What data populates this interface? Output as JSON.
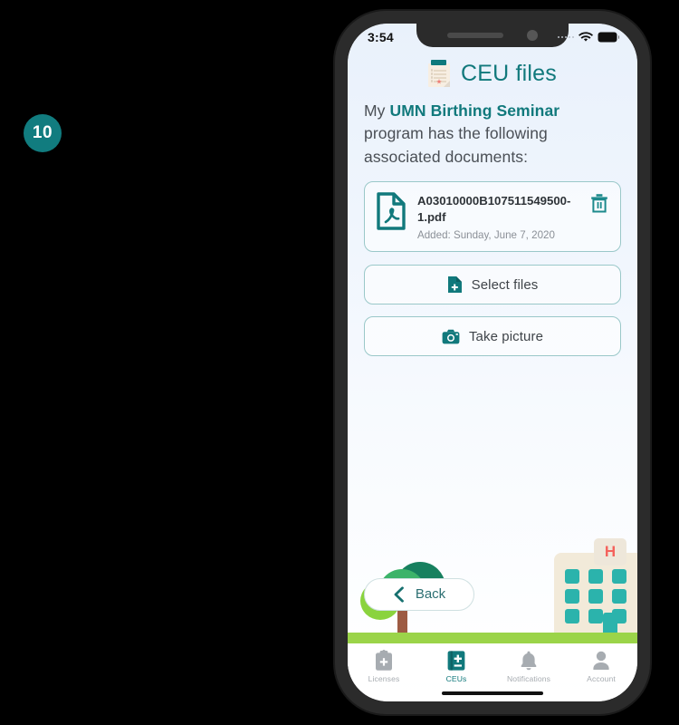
{
  "badge": {
    "number": "10"
  },
  "status_bar": {
    "time": "3:54",
    "wifi_icon": "wifi-icon",
    "battery_icon": "battery-icon",
    "cellular_icon": "cellular-dots-icon"
  },
  "header": {
    "icon": "notepad-icon",
    "title": "CEU files"
  },
  "intro": {
    "before": "My ",
    "highlight": "UMN Birthing Seminar",
    "after": " program has the following associated documents:"
  },
  "file_card": {
    "icon": "pdf-file-icon",
    "filename": "A03010000B107511549500-1.pdf",
    "added": "Added: Sunday, June 7, 2020",
    "delete_icon": "trash-icon"
  },
  "actions": [
    {
      "name": "select-files",
      "icon": "file-add-icon",
      "label": "Select files"
    },
    {
      "name": "take-picture",
      "icon": "camera-icon",
      "label": "Take picture"
    }
  ],
  "back_button": {
    "icon": "chevron-left-icon",
    "label": "Back"
  },
  "illustration": {
    "hospital_sign": "H",
    "tree_icon": "tree-illustration",
    "building_icon": "hospital-building-illustration",
    "ground_color": "#9bd449"
  },
  "tabs": [
    {
      "name": "licenses",
      "icon": "clipboard-plus-icon",
      "label": "Licenses",
      "active": false
    },
    {
      "name": "ceus",
      "icon": "book-plus-icon",
      "label": "CEUs",
      "active": true
    },
    {
      "name": "notifications",
      "icon": "bell-icon",
      "label": "Notifications",
      "active": false
    },
    {
      "name": "account",
      "icon": "person-icon",
      "label": "Account",
      "active": false
    }
  ],
  "colors": {
    "teal": "#11797c",
    "accent_green": "#9bd449",
    "muted": "#a7acb1",
    "red": "#f4625c"
  }
}
